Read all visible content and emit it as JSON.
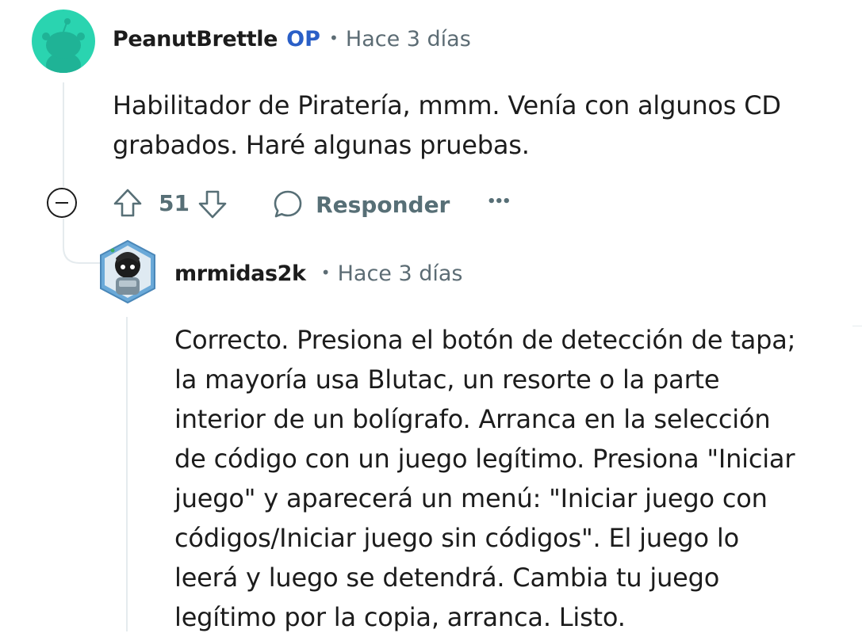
{
  "comment": {
    "author": "PeanutBrettle",
    "op_badge": "OP",
    "separator": "•",
    "time": "Hace 3 días",
    "lines": [
      "Habilitador de Piratería, mmm. Venía con algunos CD",
      "grabados. Haré algunas pruebas."
    ],
    "actions": {
      "score": "51",
      "reply_label": "Responder",
      "more_label": "•••"
    }
  },
  "reply": {
    "author": "mrmidas2k",
    "separator": "•",
    "time": "Hace 3 días",
    "lines": [
      "Correcto. Presiona el botón de detección de tapa;",
      "la mayoría usa Blutac, un resorte o la parte",
      "interior de un bolígrafo. Arranca en la selección",
      "de código con un juego legítimo. Presiona \"Iniciar",
      "juego\" y aparecerá un menú: \"Iniciar juego con",
      "códigos/Iniciar juego sin códigos\". El juego lo",
      "leerá y luego se detendrá. Cambia tu juego",
      "legítimo por la copia, arranca. Listo."
    ]
  },
  "colors": {
    "avatar_bg": "#2ad4b0",
    "op_badge": "#2a5fc7",
    "meta_text": "#5c6c74",
    "action_text": "#576f76",
    "thread_line": "#e5ebee"
  }
}
